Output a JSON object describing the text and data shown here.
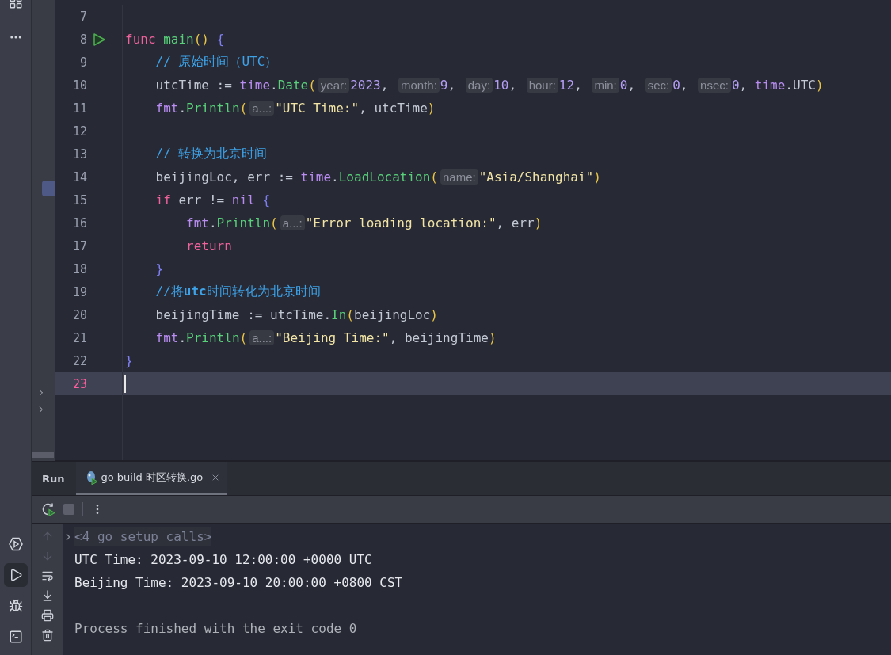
{
  "editor": {
    "lines": [
      {
        "number": "7",
        "current": false,
        "run_marker": false
      },
      {
        "number": "8",
        "current": false,
        "run_marker": true,
        "tokens": [
          {
            "kind": "keyword",
            "text": "func "
          },
          {
            "kind": "function",
            "text": "main"
          },
          {
            "kind": "paren",
            "text": "() "
          },
          {
            "kind": "brace",
            "text": "{"
          }
        ]
      },
      {
        "number": "9",
        "current": false,
        "run_marker": false,
        "tokens": [
          {
            "kind": "comment",
            "text": "    // 原始时间（UTC）"
          }
        ]
      },
      {
        "number": "10",
        "current": false,
        "run_marker": false,
        "tokens": [
          {
            "kind": "plain",
            "text": "    utcTime := "
          },
          {
            "kind": "package",
            "text": "time"
          },
          {
            "kind": "plain",
            "text": "."
          },
          {
            "kind": "function",
            "text": "Date"
          },
          {
            "kind": "paren",
            "text": "("
          },
          {
            "kind": "hint",
            "text": "year:"
          },
          {
            "kind": "number",
            "text": "2023"
          },
          {
            "kind": "plain",
            "text": ", "
          },
          {
            "kind": "hint",
            "text": "month:"
          },
          {
            "kind": "number",
            "text": "9"
          },
          {
            "kind": "plain",
            "text": ", "
          },
          {
            "kind": "hint",
            "text": "day:"
          },
          {
            "kind": "number",
            "text": "10"
          },
          {
            "kind": "plain",
            "text": ", "
          },
          {
            "kind": "hint",
            "text": "hour:"
          },
          {
            "kind": "number",
            "text": "12"
          },
          {
            "kind": "plain",
            "text": ", "
          },
          {
            "kind": "hint",
            "text": "min:"
          },
          {
            "kind": "number",
            "text": "0"
          },
          {
            "kind": "plain",
            "text": ", "
          },
          {
            "kind": "hint",
            "text": "sec:"
          },
          {
            "kind": "number",
            "text": "0"
          },
          {
            "kind": "plain",
            "text": ", "
          },
          {
            "kind": "hint",
            "text": "nsec:"
          },
          {
            "kind": "number",
            "text": "0"
          },
          {
            "kind": "plain",
            "text": ", "
          },
          {
            "kind": "package",
            "text": "time"
          },
          {
            "kind": "plain",
            "text": ".UTC"
          },
          {
            "kind": "paren",
            "text": ")"
          }
        ]
      },
      {
        "number": "11",
        "current": false,
        "run_marker": false,
        "tokens": [
          {
            "kind": "package",
            "text": "    fmt"
          },
          {
            "kind": "plain",
            "text": "."
          },
          {
            "kind": "function",
            "text": "Println"
          },
          {
            "kind": "paren",
            "text": "("
          },
          {
            "kind": "hint",
            "text": "a...:"
          },
          {
            "kind": "string",
            "text": "\"UTC Time:\""
          },
          {
            "kind": "plain",
            "text": ", utcTime"
          },
          {
            "kind": "paren",
            "text": ")"
          }
        ]
      },
      {
        "number": "12",
        "current": false,
        "run_marker": false
      },
      {
        "number": "13",
        "current": false,
        "run_marker": false,
        "tokens": [
          {
            "kind": "comment",
            "text": "    // 转换为北京时间"
          }
        ]
      },
      {
        "number": "14",
        "current": false,
        "run_marker": false,
        "tokens": [
          {
            "kind": "plain",
            "text": "    beijingLoc, err := "
          },
          {
            "kind": "package",
            "text": "time"
          },
          {
            "kind": "plain",
            "text": "."
          },
          {
            "kind": "function",
            "text": "LoadLocation"
          },
          {
            "kind": "paren",
            "text": "("
          },
          {
            "kind": "hint",
            "text": "name:"
          },
          {
            "kind": "string",
            "text": "\"Asia/Shanghai\""
          },
          {
            "kind": "paren",
            "text": ")"
          }
        ]
      },
      {
        "number": "15",
        "current": false,
        "run_marker": false,
        "tokens": [
          {
            "kind": "keyword",
            "text": "    if"
          },
          {
            "kind": "plain",
            "text": " err != "
          },
          {
            "kind": "constant",
            "text": "nil "
          },
          {
            "kind": "brace",
            "text": "{"
          }
        ]
      },
      {
        "number": "16",
        "current": false,
        "run_marker": false,
        "tokens": [
          {
            "kind": "package",
            "text": "        fmt"
          },
          {
            "kind": "plain",
            "text": "."
          },
          {
            "kind": "function",
            "text": "Println"
          },
          {
            "kind": "paren",
            "text": "("
          },
          {
            "kind": "hint",
            "text": "a...:"
          },
          {
            "kind": "string",
            "text": "\"Error loading location:\""
          },
          {
            "kind": "plain",
            "text": ", err"
          },
          {
            "kind": "paren",
            "text": ")"
          }
        ]
      },
      {
        "number": "17",
        "current": false,
        "run_marker": false,
        "tokens": [
          {
            "kind": "keyword",
            "text": "        return"
          }
        ]
      },
      {
        "number": "18",
        "current": false,
        "run_marker": false,
        "tokens": [
          {
            "kind": "brace",
            "text": "    }"
          }
        ]
      },
      {
        "number": "19",
        "current": false,
        "run_marker": false,
        "tokens": [
          {
            "kind": "comment",
            "text": "    //将**utc**时间转化为北京时间"
          }
        ]
      },
      {
        "number": "20",
        "current": false,
        "run_marker": false,
        "tokens": [
          {
            "kind": "plain",
            "text": "    beijingTime := utcTime."
          },
          {
            "kind": "function",
            "text": "In"
          },
          {
            "kind": "paren",
            "text": "("
          },
          {
            "kind": "plain",
            "text": "beijingLoc"
          },
          {
            "kind": "paren",
            "text": ")"
          }
        ]
      },
      {
        "number": "21",
        "current": false,
        "run_marker": false,
        "tokens": [
          {
            "kind": "package",
            "text": "    fmt"
          },
          {
            "kind": "plain",
            "text": "."
          },
          {
            "kind": "function",
            "text": "Println"
          },
          {
            "kind": "paren",
            "text": "("
          },
          {
            "kind": "hint",
            "text": "a...:"
          },
          {
            "kind": "string",
            "text": "\"Beijing Time:\""
          },
          {
            "kind": "plain",
            "text": ", beijingTime"
          },
          {
            "kind": "paren",
            "text": ")"
          }
        ]
      },
      {
        "number": "22",
        "current": false,
        "run_marker": false,
        "tokens": [
          {
            "kind": "brace",
            "text": "}"
          }
        ]
      },
      {
        "number": "23",
        "current": true,
        "run_marker": false
      }
    ]
  },
  "run_panel": {
    "title": "Run",
    "tabs": [
      {
        "label": "go build 时区转换.go",
        "selected": true
      }
    ],
    "console": [
      {
        "kind": "folded",
        "text": "<4 go setup calls>"
      },
      {
        "kind": "output",
        "text": "UTC Time: 2023-09-10 12:00:00 +0000 UTC"
      },
      {
        "kind": "output",
        "text": "Beijing Time: 2023-09-10 20:00:00 +0800 CST"
      },
      {
        "kind": "process",
        "text": "Process finished with the exit code 0"
      }
    ]
  }
}
